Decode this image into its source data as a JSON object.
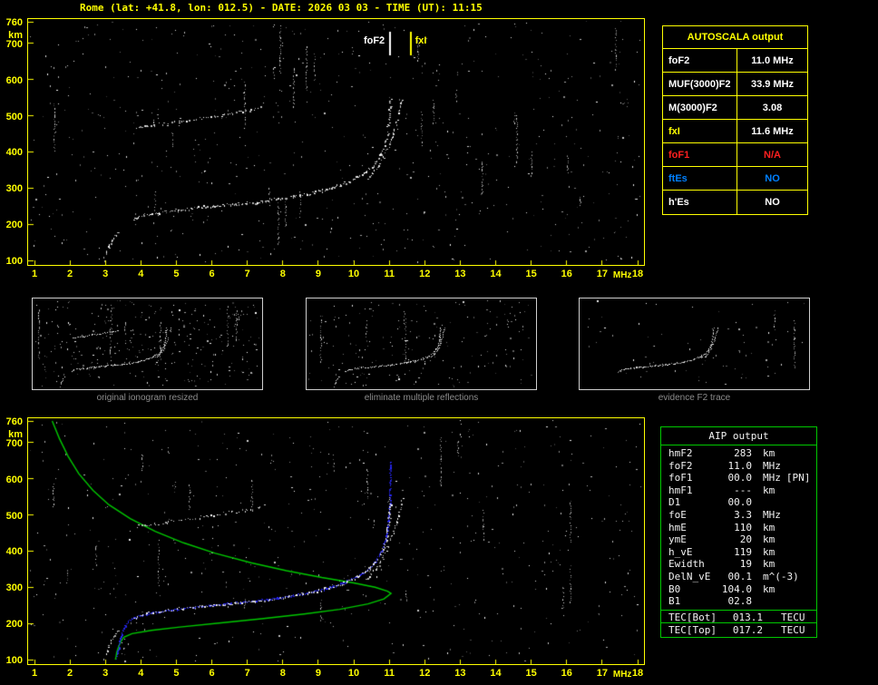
{
  "colors": {
    "background": "#000000",
    "accent_yellow": "#ffff00",
    "trace_white": "#ffffff",
    "profile_green": "#00c800",
    "restored_blue": "#2828ff",
    "error_red": "#ff2020",
    "info_blue": "#0080ff",
    "caption_gray": "#8c8c8c"
  },
  "header": {
    "title": "Rome (lat: +41.8, lon: 012.5) - DATE: 2026 03 03 - TIME (UT): 11:15"
  },
  "autoscala": {
    "title": "AUTOSCALA output",
    "rows": [
      {
        "label": "foF2",
        "value": "11.0 MHz",
        "color": "white"
      },
      {
        "label": "MUF(3000)F2",
        "value": "33.9 MHz",
        "color": "white"
      },
      {
        "label": "M(3000)F2",
        "value": "3.08",
        "color": "white"
      },
      {
        "label": "fxI",
        "value": "11.6 MHz",
        "color": "yellow"
      },
      {
        "label": "foF1",
        "value": "N/A",
        "color": "red"
      },
      {
        "label": "ftEs",
        "value": "NO",
        "color": "blue"
      },
      {
        "label": "h'Es",
        "value": "NO",
        "color": "white"
      }
    ]
  },
  "aip": {
    "title": "AIP output",
    "rows": [
      {
        "label": "hmF2",
        "value": "283",
        "unit": "km",
        "extra": ""
      },
      {
        "label": "foF2",
        "value": "11.0",
        "unit": "MHz",
        "extra": ""
      },
      {
        "label": "foF1",
        "value": "00.0",
        "unit": "MHz",
        "extra": "[PN]"
      },
      {
        "label": "hmF1",
        "value": "---",
        "unit": "km",
        "extra": ""
      },
      {
        "label": "D1",
        "value": "00.0",
        "unit": "",
        "extra": ""
      },
      {
        "label": "foE",
        "value": "3.3",
        "unit": "MHz",
        "extra": ""
      },
      {
        "label": "hmE",
        "value": "110",
        "unit": "km",
        "extra": ""
      },
      {
        "label": "ymE",
        "value": "20",
        "unit": "km",
        "extra": ""
      },
      {
        "label": "h_vE",
        "value": "119",
        "unit": "km",
        "extra": ""
      },
      {
        "label": "Ewidth",
        "value": "19",
        "unit": "km",
        "extra": ""
      },
      {
        "label": "DelN_vE",
        "value": "00.1",
        "unit": "m^(-3)",
        "extra": ""
      },
      {
        "label": "B0",
        "value": "104.0",
        "unit": "km",
        "extra": ""
      },
      {
        "label": "B1",
        "value": "02.8",
        "unit": "",
        "extra": ""
      }
    ],
    "tec_rows": [
      {
        "label": "TEC[Bot]",
        "value": "013.1",
        "unit": "TECU"
      },
      {
        "label": "TEC[Top]",
        "value": "017.2",
        "unit": "TECU"
      }
    ]
  },
  "thumbnails": [
    {
      "caption": "original ionogram resized"
    },
    {
      "caption": "eliminate multiple reflections"
    },
    {
      "caption": "evidence F2 trace"
    }
  ],
  "chart_data": [
    {
      "name": "top_ionogram",
      "type": "scatter",
      "xlabel": "MHz",
      "ylabel": "km",
      "xlim": [
        1,
        18
      ],
      "ylim": [
        100,
        760
      ],
      "x_ticks": [
        1,
        2,
        3,
        4,
        5,
        6,
        7,
        8,
        9,
        10,
        11,
        12,
        13,
        14,
        15,
        16,
        17,
        18
      ],
      "y_ticks": [
        760,
        700,
        600,
        500,
        400,
        300,
        200,
        100
      ],
      "grid": false,
      "markers": [
        {
          "label": "foF2",
          "f": 11.0,
          "color": "#ffffff",
          "label_side": "left"
        },
        {
          "label": "fxI",
          "f": 11.6,
          "color": "#ffff00",
          "label_side": "right"
        }
      ],
      "series": [
        {
          "name": "E region onset",
          "style": "dots",
          "color": "#ffffff",
          "points": [
            [
              2.95,
              100
            ],
            [
              3.0,
              113
            ],
            [
              3.06,
              128
            ],
            [
              3.12,
              143
            ],
            [
              3.2,
              158
            ],
            [
              3.3,
              172
            ],
            [
              3.42,
              183
            ]
          ]
        },
        {
          "name": "F2 o-mode trace",
          "style": "dots",
          "color": "#ffffff",
          "points": [
            [
              3.8,
              212
            ],
            [
              4.0,
              224
            ],
            [
              4.3,
              230
            ],
            [
              4.7,
              236
            ],
            [
              5.2,
              242
            ],
            [
              5.7,
              247
            ],
            [
              6.2,
              251
            ],
            [
              6.7,
              256
            ],
            [
              7.2,
              261
            ],
            [
              7.7,
              268
            ],
            [
              8.2,
              275
            ],
            [
              8.7,
              283
            ],
            [
              9.1,
              293
            ],
            [
              9.5,
              304
            ],
            [
              9.9,
              319
            ],
            [
              10.2,
              334
            ],
            [
              10.45,
              352
            ],
            [
              10.65,
              374
            ],
            [
              10.8,
              398
            ],
            [
              10.9,
              425
            ],
            [
              10.95,
              455
            ],
            [
              11.0,
              492
            ],
            [
              11.02,
              525
            ],
            [
              11.03,
              550
            ]
          ]
        },
        {
          "name": "F2 x-mode trace",
          "style": "dots",
          "color": "#ffffff",
          "points": [
            [
              10.35,
              322
            ],
            [
              10.6,
              348
            ],
            [
              10.8,
              378
            ],
            [
              10.95,
              410
            ],
            [
              11.1,
              445
            ],
            [
              11.2,
              480
            ],
            [
              11.3,
              515
            ],
            [
              11.38,
              550
            ]
          ]
        },
        {
          "name": "second hop reflection",
          "style": "dots",
          "color": "#ffffff",
          "points": [
            [
              3.9,
              468
            ],
            [
              4.3,
              473
            ],
            [
              4.8,
              480
            ],
            [
              5.4,
              489
            ],
            [
              6.0,
              498
            ],
            [
              6.6,
              508
            ],
            [
              7.1,
              517
            ],
            [
              7.5,
              527
            ]
          ]
        }
      ]
    },
    {
      "name": "bottom_ionogram_with_profile",
      "type": "scatter",
      "xlabel": "MHz",
      "ylabel": "km",
      "xlim": [
        1,
        18
      ],
      "ylim": [
        100,
        760
      ],
      "x_ticks": [
        1,
        2,
        3,
        4,
        5,
        6,
        7,
        8,
        9,
        10,
        11,
        12,
        13,
        14,
        15,
        16,
        17,
        18
      ],
      "y_ticks": [
        760,
        700,
        600,
        500,
        400,
        300,
        200,
        100
      ],
      "grid": false,
      "markers": [],
      "series": [
        {
          "name": "electron density profile",
          "style": "line",
          "color": "#00c800",
          "points": [
            [
              1.5,
              760
            ],
            [
              1.7,
              712
            ],
            [
              1.95,
              662
            ],
            [
              2.25,
              614
            ],
            [
              2.65,
              568
            ],
            [
              3.1,
              528
            ],
            [
              3.7,
              490
            ],
            [
              4.4,
              455
            ],
            [
              5.2,
              423
            ],
            [
              6.1,
              394
            ],
            [
              7.1,
              368
            ],
            [
              8.1,
              346
            ],
            [
              9.1,
              327
            ],
            [
              10.0,
              312
            ],
            [
              10.6,
              300
            ],
            [
              10.95,
              289
            ],
            [
              11.05,
              283
            ],
            [
              10.85,
              268
            ],
            [
              10.4,
              254
            ],
            [
              9.6,
              239
            ],
            [
              8.6,
              226
            ],
            [
              7.4,
              213
            ],
            [
              6.2,
              201
            ],
            [
              5.1,
              190
            ],
            [
              4.3,
              181
            ],
            [
              3.75,
              172
            ],
            [
              3.52,
              162
            ],
            [
              3.43,
              149
            ],
            [
              3.37,
              135
            ],
            [
              3.32,
              120
            ],
            [
              3.3,
              108
            ],
            [
              3.28,
              100
            ]
          ]
        },
        {
          "name": "restored trace",
          "style": "dots",
          "color": "#2828ff",
          "points": [
            [
              3.3,
              103
            ],
            [
              3.36,
              128
            ],
            [
              3.42,
              155
            ],
            [
              3.5,
              182
            ],
            [
              3.62,
              203
            ],
            [
              3.8,
              217
            ],
            [
              4.1,
              225
            ],
            [
              4.5,
              232
            ],
            [
              5.1,
              240
            ],
            [
              5.8,
              248
            ],
            [
              6.5,
              255
            ],
            [
              7.2,
              262
            ],
            [
              7.9,
              271
            ],
            [
              8.6,
              282
            ],
            [
              9.2,
              295
            ],
            [
              9.7,
              312
            ],
            [
              10.1,
              330
            ],
            [
              10.45,
              352
            ],
            [
              10.65,
              376
            ],
            [
              10.8,
              402
            ],
            [
              10.9,
              432
            ],
            [
              10.96,
              465
            ],
            [
              11.0,
              500
            ],
            [
              11.02,
              540
            ],
            [
              11.03,
              585
            ],
            [
              11.03,
              630
            ],
            [
              11.03,
              650
            ]
          ]
        },
        {
          "name": "E region onset",
          "style": "dots",
          "color": "#ffffff",
          "points": [
            [
              2.95,
              100
            ],
            [
              3.0,
              113
            ],
            [
              3.06,
              128
            ],
            [
              3.12,
              143
            ],
            [
              3.2,
              158
            ],
            [
              3.3,
              172
            ],
            [
              3.42,
              183
            ]
          ]
        },
        {
          "name": "F2 o-mode trace",
          "style": "dots",
          "color": "#ffffff",
          "points": [
            [
              3.8,
              212
            ],
            [
              4.0,
              224
            ],
            [
              4.3,
              230
            ],
            [
              4.7,
              236
            ],
            [
              5.2,
              242
            ],
            [
              5.7,
              247
            ],
            [
              6.2,
              251
            ],
            [
              6.7,
              256
            ],
            [
              7.2,
              261
            ],
            [
              7.7,
              268
            ],
            [
              8.2,
              275
            ],
            [
              8.7,
              283
            ],
            [
              9.1,
              293
            ],
            [
              9.5,
              304
            ],
            [
              9.9,
              319
            ],
            [
              10.2,
              334
            ],
            [
              10.45,
              352
            ],
            [
              10.65,
              374
            ],
            [
              10.8,
              398
            ],
            [
              10.9,
              425
            ],
            [
              10.95,
              455
            ],
            [
              11.0,
              492
            ],
            [
              11.02,
              525
            ],
            [
              11.03,
              550
            ]
          ]
        },
        {
          "name": "F2 x-mode trace",
          "style": "dots",
          "color": "#ffffff",
          "points": [
            [
              10.35,
              322
            ],
            [
              10.6,
              348
            ],
            [
              10.8,
              378
            ],
            [
              10.95,
              410
            ],
            [
              11.1,
              445
            ],
            [
              11.2,
              480
            ],
            [
              11.3,
              515
            ],
            [
              11.38,
              550
            ]
          ]
        },
        {
          "name": "second hop reflection",
          "style": "dots",
          "color": "#ffffff",
          "points": [
            [
              3.9,
              468
            ],
            [
              4.3,
              473
            ],
            [
              4.8,
              480
            ],
            [
              5.4,
              489
            ],
            [
              6.0,
              498
            ],
            [
              6.6,
              508
            ],
            [
              7.1,
              517
            ],
            [
              7.5,
              527
            ]
          ]
        }
      ]
    }
  ]
}
